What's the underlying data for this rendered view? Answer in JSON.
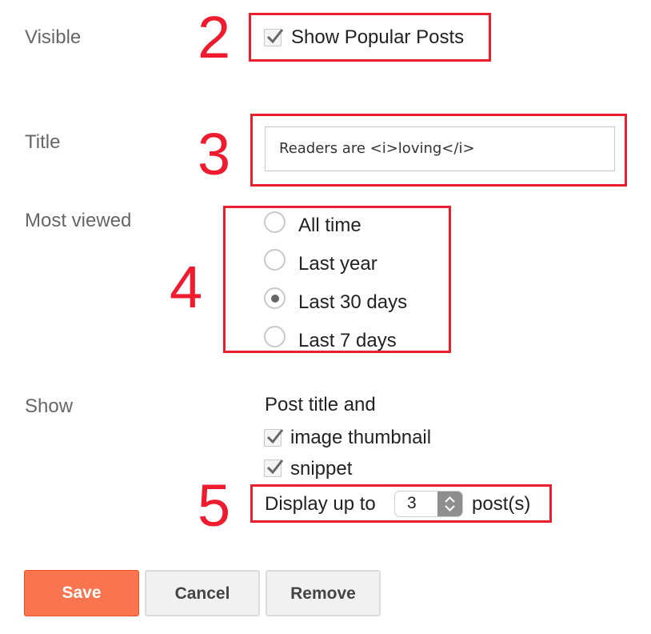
{
  "annotations": {
    "step2": "2",
    "step3": "3",
    "step4": "4",
    "step5": "5",
    "highlight_color": "#e8202e"
  },
  "visible": {
    "label": "Visible",
    "checkbox_label": "Show Popular Posts",
    "checked": true
  },
  "title": {
    "label": "Title",
    "value": "Readers are <i>loving</i>"
  },
  "most_viewed": {
    "label": "Most viewed",
    "options": [
      {
        "label": "All time",
        "selected": false
      },
      {
        "label": "Last year",
        "selected": false
      },
      {
        "label": "Last 30 days",
        "selected": true
      },
      {
        "label": "Last 7 days",
        "selected": false
      }
    ]
  },
  "show": {
    "label": "Show",
    "intro": "Post title and",
    "options": [
      {
        "label": "image thumbnail",
        "checked": true
      },
      {
        "label": "snippet",
        "checked": true
      }
    ],
    "display_prefix": "Display up to",
    "count": "3",
    "display_suffix": "post(s)"
  },
  "buttons": {
    "save": "Save",
    "cancel": "Cancel",
    "remove": "Remove",
    "save_color": "#f8754f"
  }
}
